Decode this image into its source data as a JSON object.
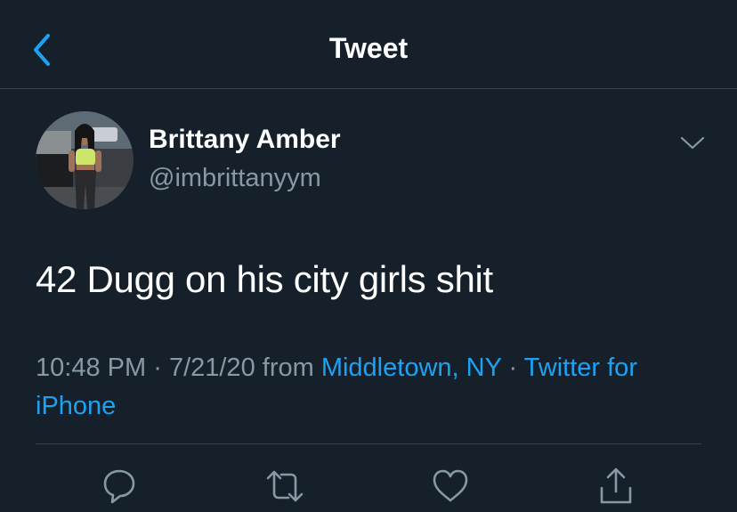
{
  "header": {
    "title": "Tweet",
    "back_icon": "chevron-left-icon",
    "accent": "#1da1f2"
  },
  "tweet": {
    "author_name": "Brittany Amber",
    "author_handle": "@imbrittanyym",
    "text": "42 Dugg on his city girls shit",
    "time": "10:48 PM",
    "date": "7/21/20",
    "from_label": "from",
    "location": "Middletown, NY",
    "source": "Twitter for iPhone",
    "sep": "·"
  },
  "actions": [
    "reply-icon",
    "retweet-icon",
    "like-icon",
    "share-icon"
  ],
  "colors": {
    "background": "#15202b",
    "secondary_text": "#8899a6",
    "divider": "#38444d"
  }
}
